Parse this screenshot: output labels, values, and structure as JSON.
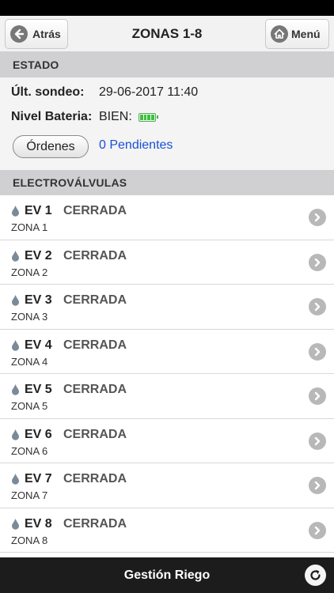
{
  "nav": {
    "back_label": "Atrás",
    "title": "ZONAS 1-8",
    "menu_label": "Menú"
  },
  "estado": {
    "header": "ESTADO",
    "ult_sondeo_label": "Últ. sondeo:",
    "ult_sondeo_value": "29-06-2017 11:40",
    "nivel_bateria_label": "Nivel Bateria:",
    "nivel_bateria_value": "BIEN:",
    "ordenes_button": "Órdenes",
    "pendientes_link": "0 Pendientes"
  },
  "electrovalvulas": {
    "header": "ELECTROVÁLVULAS",
    "items": [
      {
        "name": "EV 1",
        "state": "CERRADA",
        "zone": "ZONA 1"
      },
      {
        "name": "EV 2",
        "state": "CERRADA",
        "zone": "ZONA 2"
      },
      {
        "name": "EV 3",
        "state": "CERRADA",
        "zone": "ZONA 3"
      },
      {
        "name": "EV 4",
        "state": "CERRADA",
        "zone": "ZONA 4"
      },
      {
        "name": "EV 5",
        "state": "CERRADA",
        "zone": "ZONA 5"
      },
      {
        "name": "EV 6",
        "state": "CERRADA",
        "zone": "ZONA 6"
      },
      {
        "name": "EV 7",
        "state": "CERRADA",
        "zone": "ZONA 7"
      },
      {
        "name": "EV 8",
        "state": "CERRADA",
        "zone": "ZONA 8"
      }
    ]
  },
  "bottom_bar": {
    "title": "Gestión Riego"
  },
  "icons": {
    "back": "arrow-left-circle-icon",
    "menu": "home-icon",
    "battery": "battery-full-icon",
    "valve": "water-drop-icon",
    "row_action": "chevron-right-circle-icon",
    "refresh": "refresh-icon"
  },
  "colors": {
    "link": "#1a4fd6",
    "battery": "#3fbf3f",
    "section_header": "#d0cfd1"
  }
}
